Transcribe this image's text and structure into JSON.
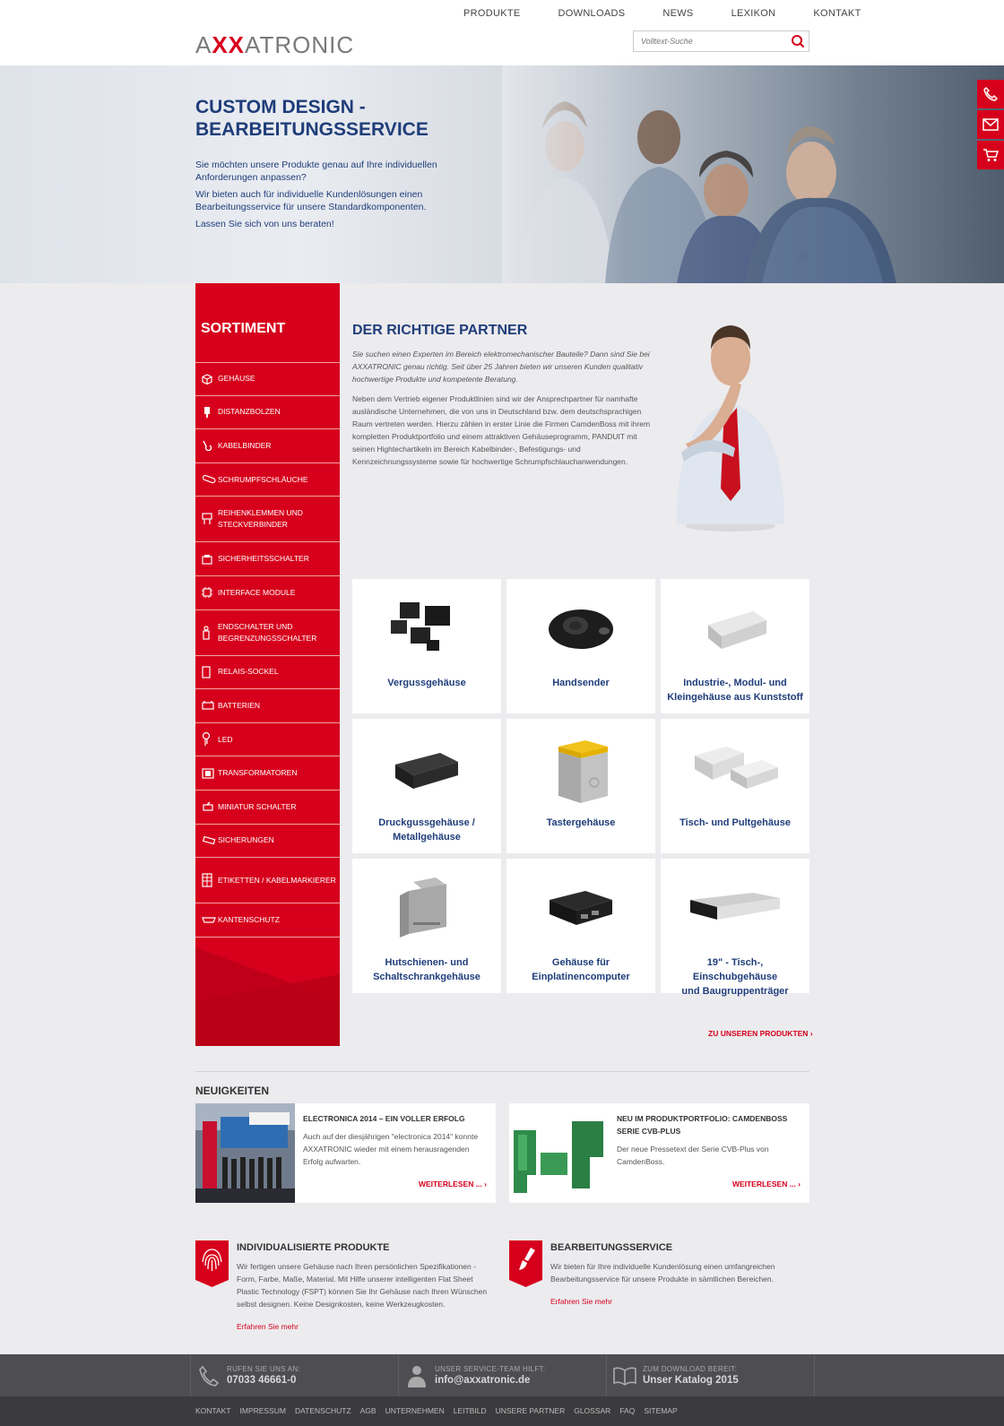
{
  "header": {
    "logo": {
      "part1": "A",
      "part2": "XX",
      "part3": "ATRONIC"
    },
    "nav": [
      "PRODUKTE",
      "DOWNLOADS",
      "NEWS",
      "LEXIKON",
      "KONTAKT"
    ],
    "search_placeholder": "Volltext-Suche"
  },
  "hero": {
    "title_line1": "CUSTOM DESIGN -",
    "title_line2": "BEARBEITUNGSSERVICE",
    "p1": "Sie möchten unsere Produkte genau auf Ihre individuellen Anforderungen anpassen?",
    "p2": "Wir bieten auch für individuelle Kundenlösungen einen Bearbeitungsservice für unsere Standardkomponenten.",
    "p3": "Lassen Sie sich von uns beraten!"
  },
  "sidebar": {
    "title": "SORTIMENT",
    "items": [
      {
        "label": "GEHÄUSE",
        "icon": "box-icon"
      },
      {
        "label": "DISTANZBOLZEN",
        "icon": "bolt-icon"
      },
      {
        "label": "KABELBINDER",
        "icon": "cable-tie-icon"
      },
      {
        "label": "SCHRUMPFSCHLÄUCHE",
        "icon": "tube-icon"
      },
      {
        "label": "REIHENKLEMMEN UND STECKVERBINDER",
        "icon": "terminal-icon"
      },
      {
        "label": "SICHERHEITSSCHALTER",
        "icon": "safety-switch-icon"
      },
      {
        "label": "INTERFACE MODULE",
        "icon": "chip-icon"
      },
      {
        "label": "ENDSCHALTER UND BEGRENZUNGSSCHALTER",
        "icon": "limit-switch-icon"
      },
      {
        "label": "RELAIS-SOCKEL",
        "icon": "relay-icon"
      },
      {
        "label": "BATTERIEN",
        "icon": "battery-icon"
      },
      {
        "label": "LED",
        "icon": "led-icon"
      },
      {
        "label": "TRANSFORMATOREN",
        "icon": "transformer-icon"
      },
      {
        "label": "MINIATUR SCHALTER",
        "icon": "mini-switch-icon"
      },
      {
        "label": "SICHERUNGEN",
        "icon": "fuse-icon"
      },
      {
        "label": "ETIKETTEN / KABELMARKIERER",
        "icon": "label-icon"
      },
      {
        "label": "KANTENSCHUTZ",
        "icon": "edge-guard-icon"
      }
    ]
  },
  "partner": {
    "title": "DER RICHTIGE PARTNER",
    "intro": "Sie suchen einen Experten im Bereich elektromechanischer Bauteile? Dann sind Sie bei AXXATRONIC genau richtig. Seit über 25 Jahren bieten wir unseren Kunden qualitativ hochwertige Produkte und kompetente Beratung.",
    "body": "Neben dem Vertrieb eigener Produktlinien sind wir der Ansprechpartner für namhafte ausländische Unternehmen, die von uns in Deutschland bzw. dem deutschsprachigen Raum vertreten werden. Hierzu zählen in erster Linie die Firmen CamdenBoss mit ihrem kompletten Produktportfolio und einem attraktiven Gehäuseprogramm, PANDUIT mit seinen Hightechartikeln im Bereich Kabelbinder-, Befestigungs- und Kennzeichnungssysteme sowie für hochwertige Schrumpfschlauchanwendungen."
  },
  "products": [
    {
      "line1": "Vergussgehäuse",
      "line2": ""
    },
    {
      "line1": "Handsender",
      "line2": ""
    },
    {
      "line1": "Industrie-, Modul- und",
      "line2": "Kleingehäuse aus Kunststoff"
    },
    {
      "line1": "Druckgussgehäuse /",
      "line2": "Metallgehäuse"
    },
    {
      "line1": "Tastergehäuse",
      "line2": ""
    },
    {
      "line1": "Tisch- und Pultgehäuse",
      "line2": ""
    },
    {
      "line1": "Hutschienen- und",
      "line2": "Schaltschrankgehäuse"
    },
    {
      "line1": "Gehäuse für",
      "line2": "Einplatinencomputer"
    },
    {
      "line1": "19\" - Tisch-, Einschubgehäuse",
      "line2": "und Baugruppenträger"
    }
  ],
  "products_link": "ZU UNSEREN PRODUKTEN",
  "news": {
    "title": "NEUIGKEITEN",
    "items": [
      {
        "title": "ELECTRONICA 2014 – EIN VOLLER ERFOLG",
        "text": "Auch auf der diesjährigen \"electronica 2014\" konnte AXXATRONIC wieder mit einem herausragenden Erfolg aufwarten.",
        "more": "WEITERLESEN ..."
      },
      {
        "title": "NEU IM PRODUKTPORTFOLIO: CAMDENBOSS SERIE CVB-PLUS",
        "text": "Der neue Pressetext der Serie CVB-Plus von CamdenBoss.",
        "more": "WEITERLESEN ..."
      }
    ]
  },
  "features": [
    {
      "title": "INDIVIDUALISIERTE PRODUKTE",
      "text": "Wir fertigen unsere Gehäuse nach Ihren persönlichen Spezifikationen - Form, Farbe, Maße, Material. Mit Hilfe unserer intelligenten Flat Sheet Plastic Technology (FSPT) können Sie Ihr Gehäuse nach Ihren Wünschen selbst designen. Keine Designkosten, keine Werkzeugkosten.",
      "more": "Erfahren Sie mehr"
    },
    {
      "title": "BEARBEITUNGSSERVICE",
      "text": "Wir bieten für Ihre individuelle Kundenlösung einen umfangreichen Bearbeitungsservice für unsere Produkte in sämtlichen Bereichen.",
      "more": "Erfahren Sie mehr"
    }
  ],
  "footer": {
    "phone_label": "RUFEN SIE UNS AN:",
    "phone": "07033 46661-0",
    "service_label": "UNSER SERVICE-TEAM HILFT:",
    "email": "info@axxatronic.de",
    "download_label": "ZUM DOWNLOAD BEREIT:",
    "catalog": "Unser Katalog 2015",
    "links": [
      "KONTAKT",
      "IMPRESSUM",
      "DATENSCHUTZ",
      "AGB",
      "UNTERNEHMEN",
      "LEITBILD",
      "UNSERE PARTNER",
      "GLOSSAR",
      "FAQ",
      "SITEMAP"
    ]
  },
  "colors": {
    "accent": "#d6001c",
    "navy": "#1f3d7a",
    "footer": "#4e4e52"
  }
}
